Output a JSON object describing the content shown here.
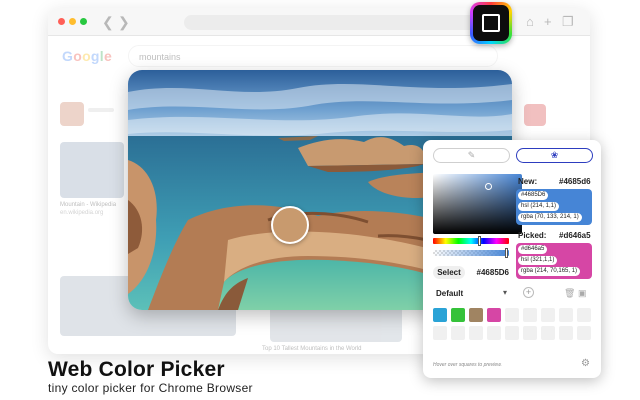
{
  "browser": {
    "window_dots": [
      "#ff5f57",
      "#ffbd2e",
      "#28c840"
    ],
    "search": {
      "logo": "Google",
      "query": "mountains",
      "result_captions": [
        "Mountain - Wikipedia",
        "en.wikipedia.org"
      ],
      "bottom_caption": "Top 10 Tallest Mountains in the World"
    }
  },
  "photo": {
    "sampled_color": "#c89a6e"
  },
  "picker": {
    "modes": [
      {
        "name": "eyedropper",
        "icon": "eyedropper-icon",
        "active": false
      },
      {
        "name": "palette",
        "icon": "palette-icon",
        "active": true
      }
    ],
    "select_label": "Select",
    "select_hex": "#4685D6",
    "new": {
      "label": "New:",
      "hex": "#4685d6",
      "color": "#4685d6",
      "formats": [
        "#4685D6",
        "hsl (214, 1,1)",
        "rgba (70, 133, 214, 1)"
      ]
    },
    "picked": {
      "label": "Picked:",
      "hex": "#d646a5",
      "color": "#d646a5",
      "formats": [
        "#d646a5",
        "hsl (321,1,1)",
        "rgba (214, 70,165, 1)"
      ]
    },
    "palette": {
      "name": "Default",
      "swatches": [
        "#2aa3d6",
        "#35c23a",
        "#a08462",
        "#d646a5"
      ]
    },
    "hint": "Hover over squares to preview."
  },
  "captions": {
    "title": "Web Color Picker",
    "subtitle": "tiny color picker for Chrome Browser"
  }
}
